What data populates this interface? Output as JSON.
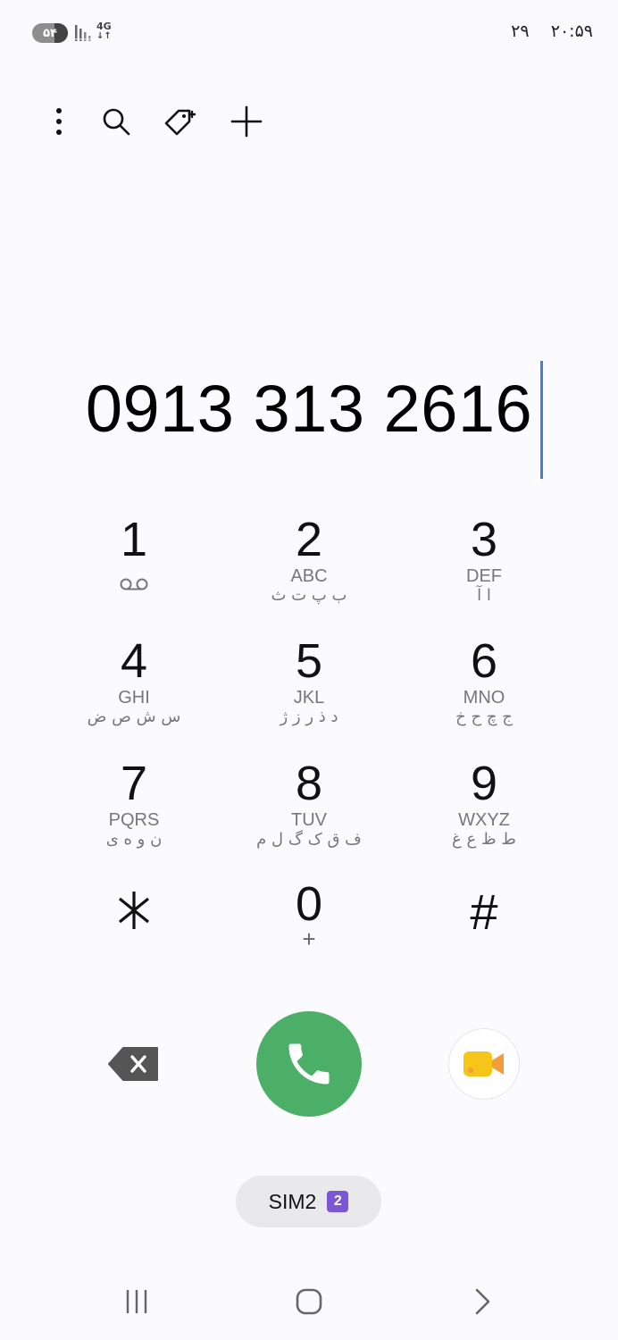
{
  "status_bar": {
    "battery_level": "۵۴",
    "network_type": "4G",
    "date": "۲۹",
    "time": "۲۰:۵۹"
  },
  "toolbar": {
    "icons": [
      "more-options-icon",
      "search-icon",
      "tag-icon",
      "add-icon"
    ]
  },
  "dialer": {
    "number": "0913 313 2616"
  },
  "keypad": {
    "k1": {
      "digit": "1",
      "sub": "voicemail-icon"
    },
    "k2": {
      "digit": "2",
      "latin": "ABC",
      "persian": "ب پ ت ث"
    },
    "k3": {
      "digit": "3",
      "latin": "DEF",
      "persian": "ا آ"
    },
    "k4": {
      "digit": "4",
      "latin": "GHI",
      "persian": "س ش ص ض"
    },
    "k5": {
      "digit": "5",
      "latin": "JKL",
      "persian": "د ذ ر ز ژ"
    },
    "k6": {
      "digit": "6",
      "latin": "MNO",
      "persian": "ج چ ح خ"
    },
    "k7": {
      "digit": "7",
      "latin": "PQRS",
      "persian": "ن و ه ی"
    },
    "k8": {
      "digit": "8",
      "latin": "TUV",
      "persian": "ف ق ک گ ل م"
    },
    "k9": {
      "digit": "9",
      "latin": "WXYZ",
      "persian": "ط ظ ع غ"
    },
    "kstar": {
      "digit": "*"
    },
    "k0": {
      "digit": "0",
      "sub": "+"
    },
    "khash": {
      "digit": "#"
    }
  },
  "actions": {
    "sim_label": "SIM2",
    "sim_badge": "2"
  },
  "colors": {
    "call_green": "#4caf68",
    "caret_blue": "#4a7fc8",
    "sim_badge": "#7b57d6"
  }
}
